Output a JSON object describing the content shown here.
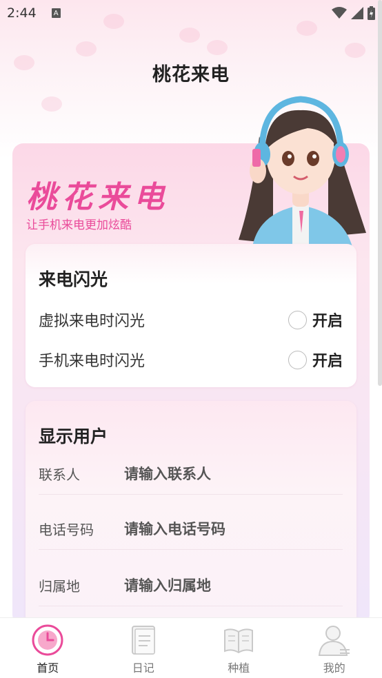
{
  "status_bar": {
    "time": "2:44",
    "sim_label": "A"
  },
  "page_title": "桃花来电",
  "banner": {
    "brand": "桃花来电",
    "slogan": "让手机来电更加炫酷"
  },
  "flash_card": {
    "title": "来电闪光",
    "rows": [
      {
        "label": "虚拟来电时闪光",
        "state": "开启",
        "checked": false
      },
      {
        "label": "手机来电时闪光",
        "state": "开启",
        "checked": false
      }
    ]
  },
  "user_card": {
    "title": "显示用户",
    "fields": [
      {
        "label": "联系人",
        "placeholder": "请输入联系人",
        "value": ""
      },
      {
        "label": "电话号码",
        "placeholder": "请输入电话号码",
        "value": ""
      },
      {
        "label": "归属地",
        "placeholder": "请输入归属地",
        "value": ""
      }
    ]
  },
  "tabbar": {
    "tabs": [
      {
        "label": "首页",
        "icon": "clock-icon",
        "active": true
      },
      {
        "label": "日记",
        "icon": "notebook-icon",
        "active": false
      },
      {
        "label": "种植",
        "icon": "book-icon",
        "active": false
      },
      {
        "label": "我的",
        "icon": "person-icon",
        "active": false
      }
    ]
  },
  "colors": {
    "accent": "#ea4b9a",
    "banner_bg": "#fce6ef",
    "text": "#222222"
  }
}
